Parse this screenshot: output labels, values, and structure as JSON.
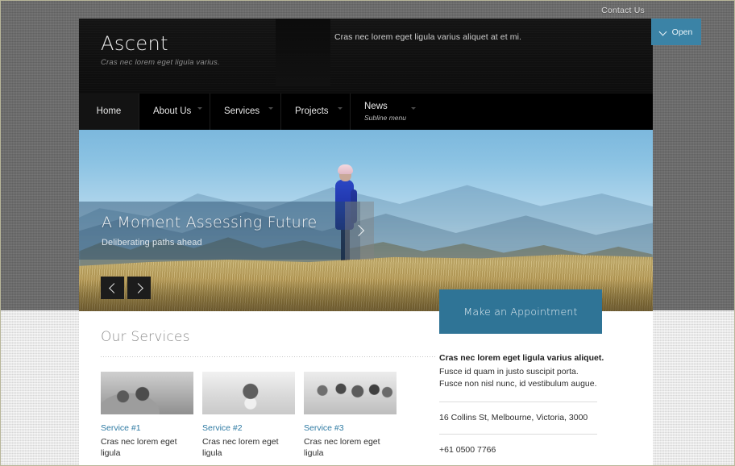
{
  "topbar": {
    "contact_label": "Contact Us"
  },
  "header": {
    "site_title": "Ascent",
    "site_tagline": "Cras nec lorem eget ligula varius.",
    "header_tagline": "Cras nec lorem eget ligula varius aliquet at et mi.",
    "open_label": "Open",
    "open_icon": "chevron-down-icon",
    "accent_color": "#3b83a6"
  },
  "nav": {
    "items": [
      {
        "label": "Home",
        "subline": "",
        "has_arrow": false,
        "active": true
      },
      {
        "label": "About Us",
        "subline": "",
        "has_arrow": true,
        "active": false
      },
      {
        "label": "Services",
        "subline": "",
        "has_arrow": true,
        "active": false
      },
      {
        "label": "Projects",
        "subline": "",
        "has_arrow": true,
        "active": false
      },
      {
        "label": "News",
        "subline": "Subline menu",
        "has_arrow": true,
        "active": false
      }
    ]
  },
  "hero": {
    "title": "A Moment Assessing Future",
    "subtitle": "Deliberating paths ahead",
    "more_icon": "chevron-right-icon",
    "prev_icon": "chevron-left-icon",
    "next_icon": "chevron-right-icon"
  },
  "main": {
    "services_heading": "Our Services",
    "services": [
      {
        "title": "Service #1",
        "desc": "Cras nec lorem eget ligula",
        "thumb": "photo-couple-outdoors"
      },
      {
        "title": "Service #2",
        "desc": "Cras nec lorem eget ligula",
        "thumb": "photo-woman-coffee"
      },
      {
        "title": "Service #3",
        "desc": "Cras nec lorem eget ligula",
        "thumb": "photo-group-people"
      }
    ],
    "link_color": "#2e7aa3"
  },
  "sidebar": {
    "appointment_label": "Make an Appointment",
    "heading": "Cras nec lorem eget ligula varius aliquet.",
    "paragraph": "Fusce id quam in justo suscipit porta. Fusce non nisl nunc, id vestibulum augue.",
    "address": "16 Collins St, Melbourne, Victoria, 3000",
    "phone": "+61 0500 7766",
    "button_color": "#2f7496"
  }
}
